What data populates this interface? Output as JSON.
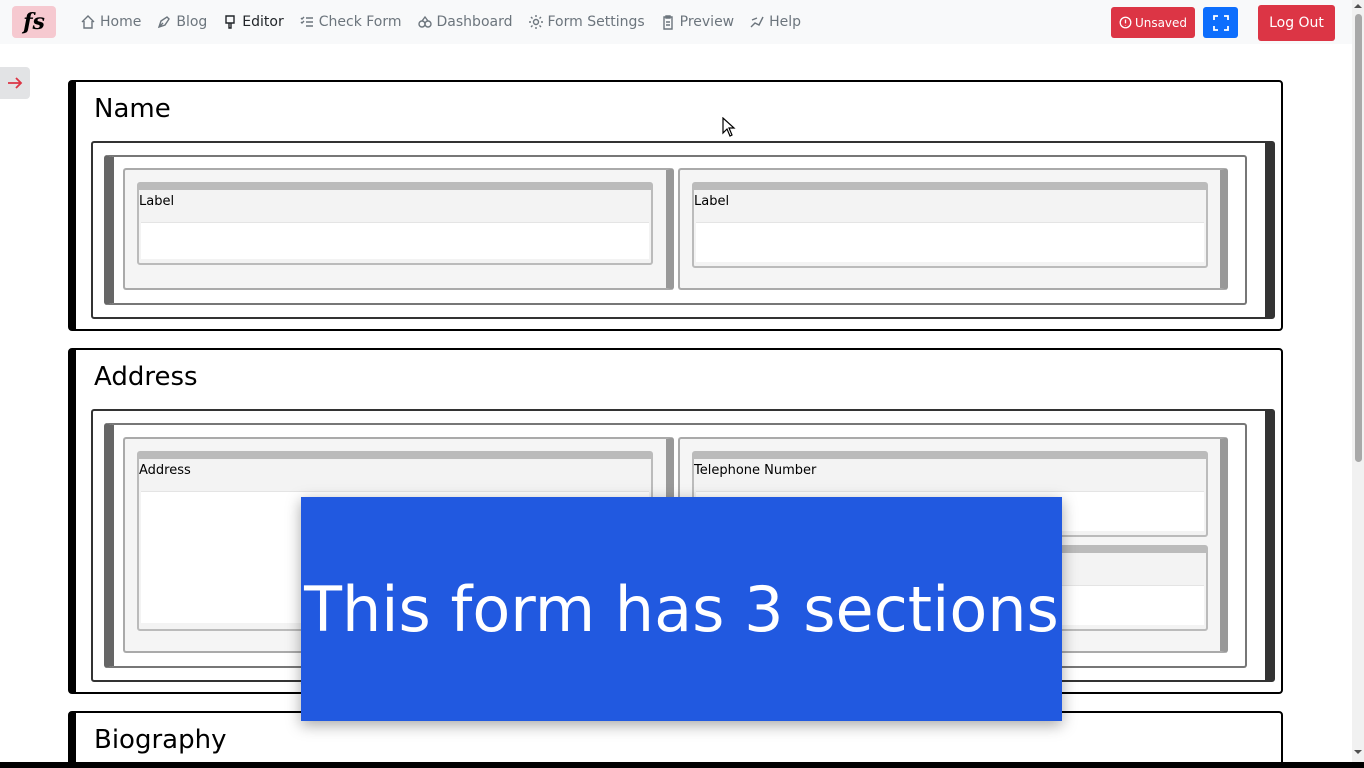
{
  "logo": {
    "text": "fs"
  },
  "nav": {
    "items": [
      {
        "label": "Home",
        "icon": "home-icon"
      },
      {
        "label": "Blog",
        "icon": "blog-icon"
      },
      {
        "label": "Editor",
        "icon": "editor-icon"
      },
      {
        "label": "Check Form",
        "icon": "checklist-icon"
      },
      {
        "label": "Dashboard",
        "icon": "dashboard-icon"
      },
      {
        "label": "Form Settings",
        "icon": "gear-icon"
      },
      {
        "label": "Preview",
        "icon": "clipboard-icon"
      },
      {
        "label": "Help",
        "icon": "help-icon"
      }
    ],
    "active": "Editor",
    "unsaved_label": "Unsaved",
    "logout_label": "Log Out"
  },
  "colors": {
    "danger": "#dc3545",
    "primary": "#0d6efd",
    "overlay": "#2159e0"
  },
  "sections": [
    {
      "title": "Name",
      "fields_left": [
        "Label"
      ],
      "fields_right": [
        "Label"
      ]
    },
    {
      "title": "Address",
      "fields_left": [
        "Address"
      ],
      "fields_right": [
        "Telephone Number",
        ""
      ]
    },
    {
      "title": "Biography"
    }
  ],
  "overlay": {
    "text": "This form has 3 sections"
  }
}
